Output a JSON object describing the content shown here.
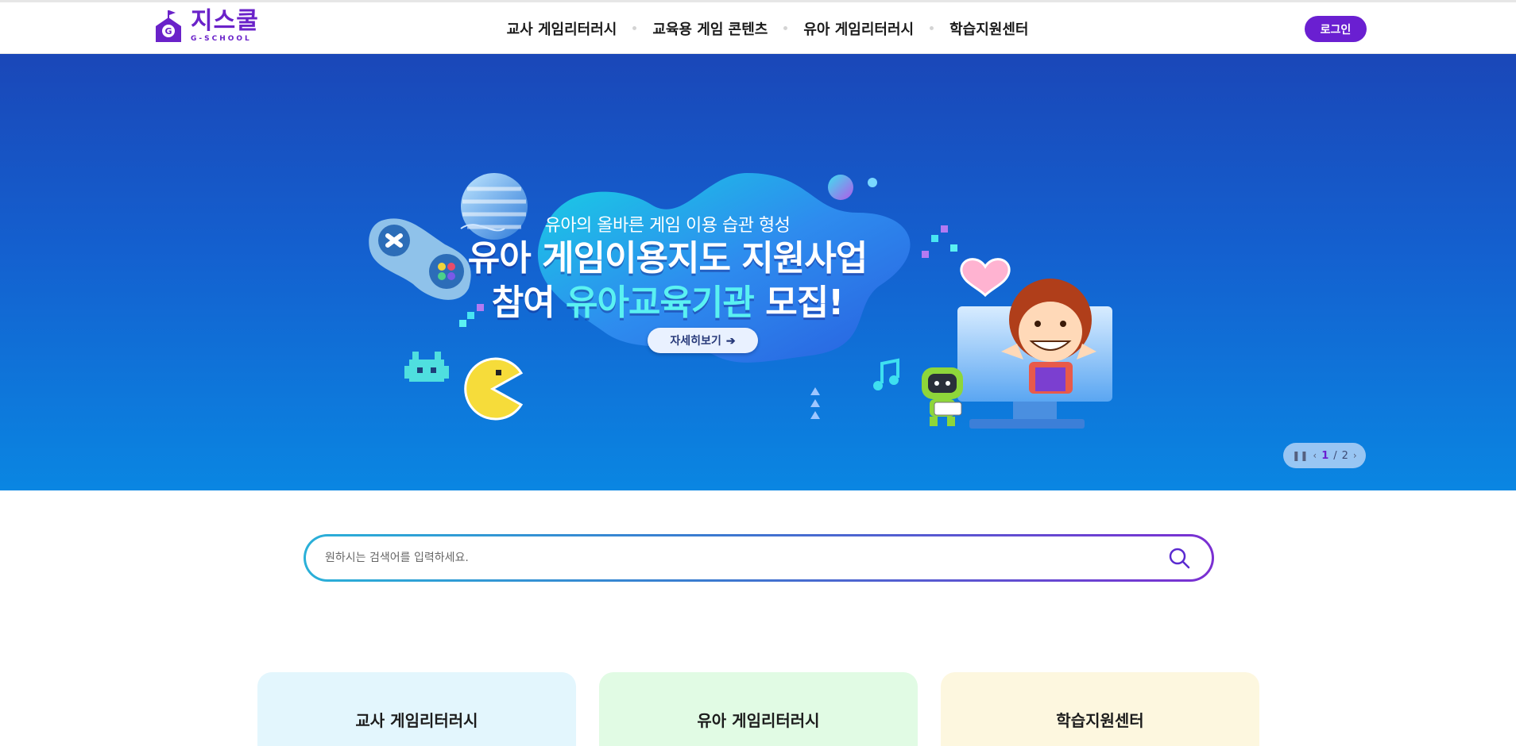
{
  "header": {
    "logo_main": "지스쿨",
    "logo_sub": "G-SCHOOL",
    "nav": [
      {
        "label": "교사 게임리터러시"
      },
      {
        "label": "교육용 게임 콘텐츠"
      },
      {
        "label": "유아 게임리터러시"
      },
      {
        "label": "학습지원센터"
      }
    ],
    "login_label": "로그인",
    "brand_color": "#6a1fd1"
  },
  "banner": {
    "subtitle": "유아의 올바른 게임 이용 습관 형성",
    "title_line1": "유아 게임이용지도 지원사업",
    "title_line2_pre": "참여 ",
    "title_line2_highlight": "유아교육기관",
    "title_line2_post": " 모집!",
    "more_label": "자세히보기",
    "pager": {
      "current": "1",
      "separator": "/",
      "total": "2"
    }
  },
  "search": {
    "placeholder": "원하시는 검색어를 입력하세요."
  },
  "cards": [
    {
      "title": "교사 게임리터러시"
    },
    {
      "title": "유아 게임리터러시"
    },
    {
      "title": "학습지원센터"
    }
  ]
}
